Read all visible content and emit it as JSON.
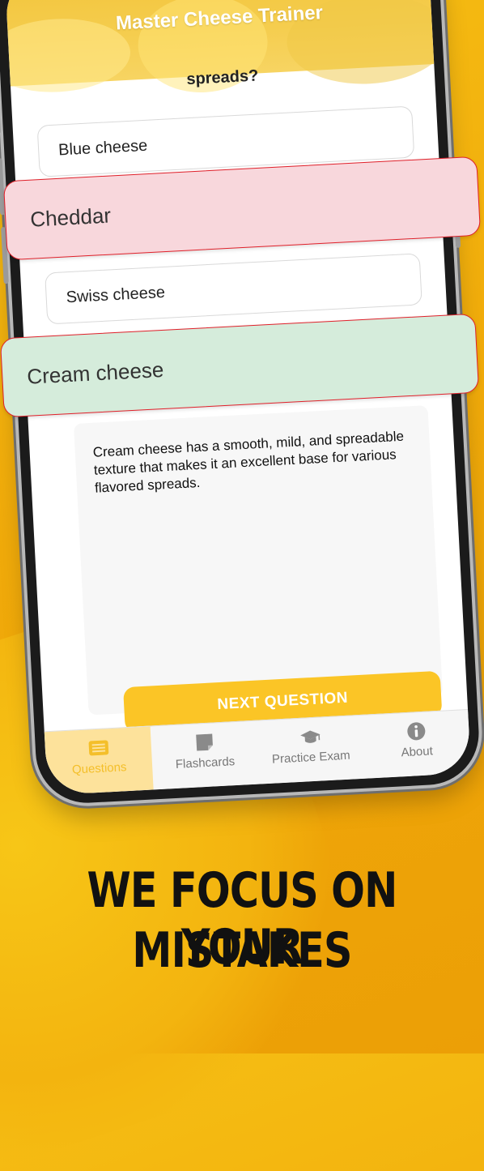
{
  "app": {
    "title": "Master Cheese Trainer",
    "question_tail": "spreads?"
  },
  "answers": [
    {
      "label": "Blue cheese",
      "state": "neutral"
    },
    {
      "label": "Cheddar",
      "state": "wrong"
    },
    {
      "label": "Swiss cheese",
      "state": "neutral"
    },
    {
      "label": "Cream cheese",
      "state": "correct"
    }
  ],
  "explanation": {
    "text": "Cream cheese has a smooth, mild, and spreadable texture that makes it an excellent base for various flavored spreads."
  },
  "next_button": {
    "label": "NEXT QUESTION"
  },
  "tabbar": {
    "tabs": [
      {
        "label": "Questions",
        "icon": "questions-icon",
        "active": true
      },
      {
        "label": "Flashcards",
        "icon": "flashcards-icon",
        "active": false
      },
      {
        "label": "Practice Exam",
        "icon": "graduation-cap-icon",
        "active": false
      },
      {
        "label": "About",
        "icon": "info-icon",
        "active": false
      }
    ]
  },
  "marketing": {
    "headline_line1": "We focus on your",
    "headline_line2": "mistakes"
  },
  "colors": {
    "background": "#f0aa0a",
    "accent": "#fbc526",
    "wrong_fill": "#f8d7dc",
    "correct_fill": "#d5ecdb",
    "highlight_border": "#e0202a"
  }
}
